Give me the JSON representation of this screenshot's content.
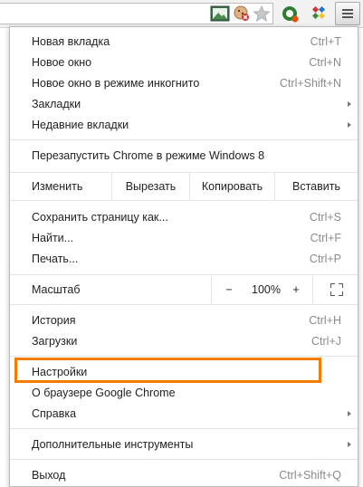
{
  "menu": {
    "items_group1": [
      {
        "label": "Новая вкладка",
        "shortcut": "Ctrl+T"
      },
      {
        "label": "Новое окно",
        "shortcut": "Ctrl+N"
      },
      {
        "label": "Новое окно в режиме инкогнито",
        "shortcut": "Ctrl+Shift+N"
      },
      {
        "label": "Закладки",
        "shortcut": ""
      },
      {
        "label": "Недавние вкладки",
        "shortcut": ""
      }
    ],
    "relaunch_label": "Перезапустить Chrome в режиме Windows 8",
    "edit": {
      "label": "Изменить",
      "cut": "Вырезать",
      "copy": "Копировать",
      "paste": "Вставить"
    },
    "items_group3": [
      {
        "label": "Сохранить страницу как...",
        "shortcut": "Ctrl+S"
      },
      {
        "label": "Найти...",
        "shortcut": "Ctrl+F"
      },
      {
        "label": "Печать...",
        "shortcut": "Ctrl+P"
      }
    ],
    "zoom": {
      "label": "Масштаб",
      "minus": "−",
      "value": "100%",
      "plus": "+"
    },
    "items_group5": [
      {
        "label": "История",
        "shortcut": "Ctrl+H"
      },
      {
        "label": "Загрузки",
        "shortcut": "Ctrl+J"
      }
    ],
    "items_group6": [
      {
        "label": "Настройки",
        "shortcut": ""
      },
      {
        "label": "О браузере Google Chrome",
        "shortcut": ""
      },
      {
        "label": "Справка",
        "shortcut": ""
      }
    ],
    "more_tools_label": "Дополнительные инструменты",
    "exit": {
      "label": "Выход",
      "shortcut": "Ctrl+Shift+Q"
    }
  },
  "colors": {
    "highlight": "#f57c00"
  },
  "icons": [
    "picture-icon",
    "cookie-blocked-icon",
    "bookmark-star-icon",
    "extension-green-icon",
    "extension-x-icon",
    "hamburger-menu-icon",
    "fullscreen-icon",
    "submenu-arrow-icon"
  ]
}
